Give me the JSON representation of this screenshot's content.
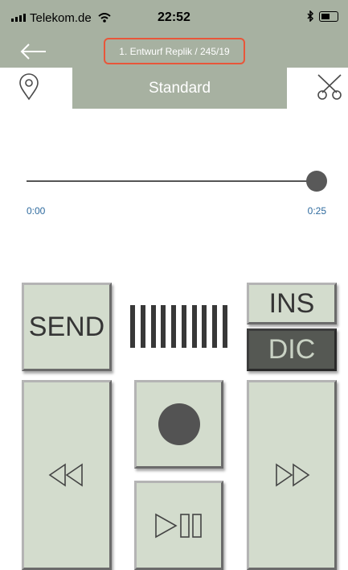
{
  "status_bar": {
    "carrier": "Telekom.de",
    "time": "22:52"
  },
  "nav": {
    "title": "1. Entwurf Replik / 245/19"
  },
  "tabs": {
    "standard_label": "Standard"
  },
  "slider": {
    "start_time": "0:00",
    "end_time": "0:25",
    "position": 1.0
  },
  "buttons": {
    "send_label": "SEND",
    "ins_label": "INS",
    "dic_label": "DIC"
  },
  "colors": {
    "header_bg": "#a7b1a1",
    "button_bg": "#d3dccd",
    "active_button_bg": "#555853",
    "highlight_border": "#e8563a",
    "time_text": "#2e6a9e"
  },
  "icons": [
    "back-arrow-icon",
    "location-pin-icon",
    "scissors-icon",
    "rewind-icon",
    "record-icon",
    "play-pause-icon",
    "fast-forward-icon"
  ]
}
